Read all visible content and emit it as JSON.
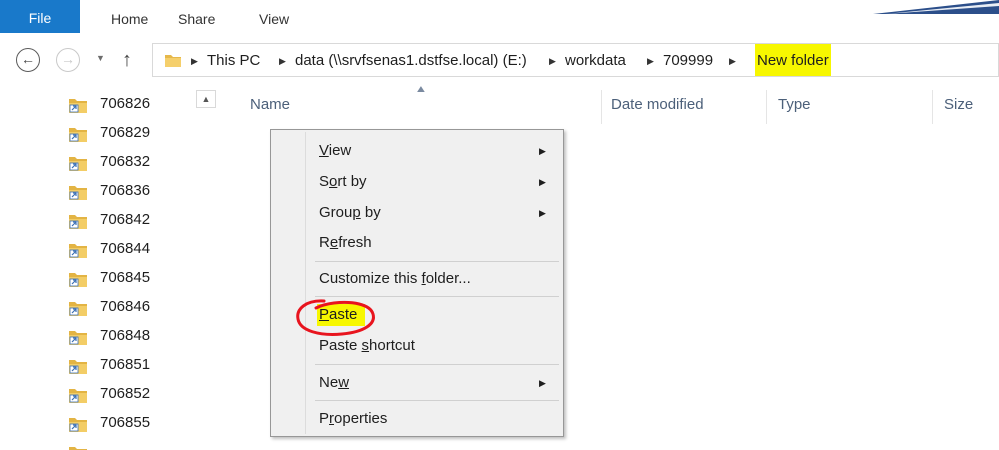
{
  "ribbon": {
    "tabs": [
      "File",
      "Home",
      "Share",
      "View"
    ],
    "accent_color": "#1979ca"
  },
  "nav": {
    "back_icon": "back-arrow-icon",
    "forward_icon": "forward-arrow-icon",
    "recent_icon": "chevron-down-icon",
    "up_icon": "up-arrow-icon"
  },
  "address": {
    "crumbs": [
      "This PC",
      "data (\\\\srvfsenas1.dstfse.local) (E:)",
      "workdata",
      "709999",
      "New folder"
    ],
    "highlight_color": "#f7f700"
  },
  "tree": {
    "items": [
      "706826",
      "706829",
      "706832",
      "706836",
      "706842",
      "706844",
      "706845",
      "706846",
      "706848",
      "706851",
      "706852",
      "706855"
    ],
    "icon": "folder-shortcut-icon"
  },
  "columns": {
    "name": "Name",
    "date_modified": "Date modified",
    "type": "Type",
    "size": "Size"
  },
  "context_menu": {
    "items": [
      {
        "pre": "",
        "key": "V",
        "post": "iew",
        "submenu": true
      },
      {
        "pre": "S",
        "key": "o",
        "post": "rt by",
        "submenu": true
      },
      {
        "pre": "Grou",
        "key": "p",
        "post": " by",
        "submenu": true
      },
      {
        "pre": "R",
        "key": "e",
        "post": "fresh",
        "submenu": false
      },
      {
        "pre": "Customize this ",
        "key": "f",
        "post": "older...",
        "submenu": false
      },
      {
        "pre": "",
        "key": "P",
        "post": "aste",
        "submenu": false
      },
      {
        "pre": "Paste ",
        "key": "s",
        "post": "hortcut",
        "submenu": false
      },
      {
        "pre": "Ne",
        "key": "w",
        "post": "",
        "submenu": true
      },
      {
        "pre": "P",
        "key": "r",
        "post": "operties",
        "submenu": false
      }
    ],
    "annotation_color": "#e8141e"
  }
}
